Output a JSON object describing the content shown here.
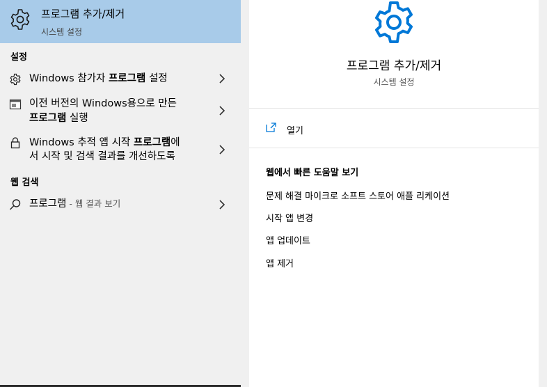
{
  "top_result": {
    "title": "프로그램 추가/제거",
    "subtitle": "시스템 설정",
    "icon": "gear-icon"
  },
  "sections": {
    "settings_label": "설정",
    "web_label": "웹 검색"
  },
  "settings_items": [
    {
      "icon": "gear-small-icon",
      "text_pre": "Windows 참가자 ",
      "text_bold": "프로그램",
      "text_post": " 설정"
    },
    {
      "icon": "legacy-app-icon",
      "line1": "이전 버전의 Windows용으로 만든",
      "line2_bold": "프로그램",
      "line2_post": " 실행"
    },
    {
      "icon": "lock-icon",
      "line1_pre": "Windows 추적 앱 시작 ",
      "line1_bold": "프로그램",
      "line1_post": "에",
      "line2": "서 시작 및 검색 결과를 개선하도록"
    }
  ],
  "web_item": {
    "icon": "search-icon",
    "query": "프로그램",
    "suffix": " - 웹 결과 보기"
  },
  "detail": {
    "title": "프로그램 추가/제거",
    "subtitle": "시스템 설정",
    "open_label": "열기",
    "web_help_heading": "웹에서 빠른 도움말 보기",
    "links": [
      "문제 해결 마이크로 소프트 스토어 애플 리케이션",
      "시작 앱 변경",
      "앱 업데이트",
      "앱 제거"
    ]
  },
  "colors": {
    "selected_bg": "#a8cbe9",
    "accent_blue": "#0078d7",
    "panel_bg": "#f0f0f0"
  }
}
